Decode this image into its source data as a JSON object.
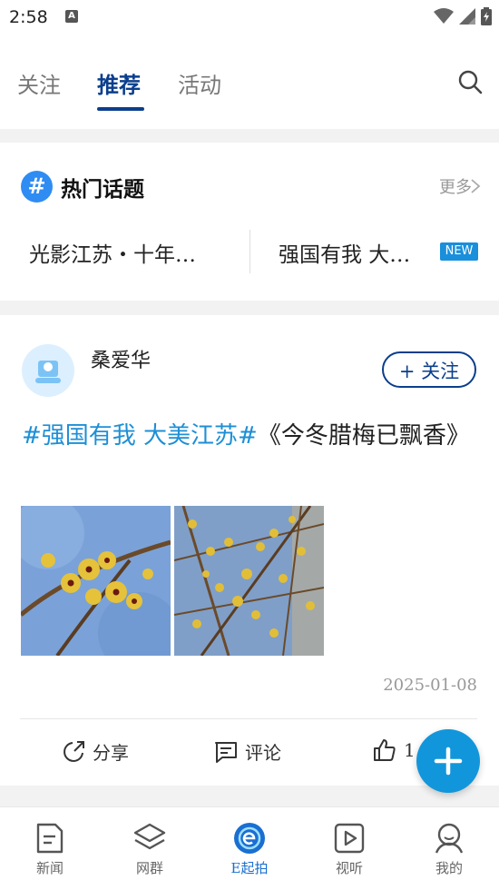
{
  "status_bar": {
    "time": "2:58",
    "a_badge": "A"
  },
  "header": {
    "tabs": [
      {
        "label": "关注"
      },
      {
        "label": "推荐"
      },
      {
        "label": "活动"
      }
    ],
    "active_tab": "推荐"
  },
  "hot_topics": {
    "icon": "#",
    "title": "热门话题",
    "more_label": "更多",
    "topics": [
      {
        "label": "光影江苏・十年…"
      },
      {
        "label": "强国有我  大…",
        "badge": "NEW"
      }
    ]
  },
  "post": {
    "author": "桑爱华",
    "follow_label": "+ 关注",
    "hashtag": "#强国有我  大美江苏#",
    "text": "《今冬腊梅已飘香》",
    "date": "2025-01-08",
    "actions": {
      "share": "分享",
      "comment": "评论",
      "like_count": "1"
    }
  },
  "bottom_nav": {
    "items": [
      {
        "label": "新闻"
      },
      {
        "label": "网群"
      },
      {
        "label": "E起拍"
      },
      {
        "label": "视听"
      },
      {
        "label": "我的"
      }
    ],
    "active": "E起拍"
  },
  "colors": {
    "brand_blue": "#0b3e8c",
    "link_blue": "#1e8fd6",
    "fab_blue": "#1296db",
    "topic_icon_blue": "#2f8cf3"
  }
}
